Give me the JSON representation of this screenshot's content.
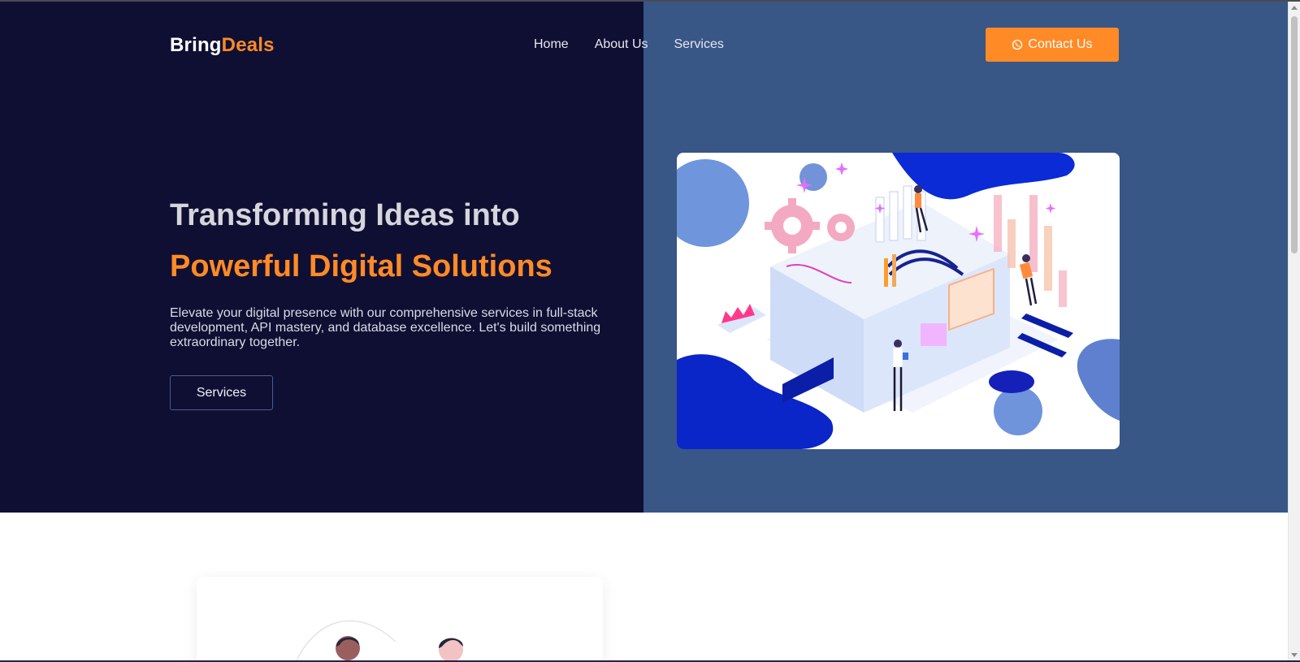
{
  "brand": {
    "part1": "Bring",
    "part2": "Deals"
  },
  "nav": {
    "items": [
      "Home",
      "About Us",
      "Services"
    ]
  },
  "header": {
    "contact_label": "Contact Us",
    "contact_icon": "whatsapp-icon"
  },
  "hero": {
    "title_line1": "Transforming Ideas into",
    "title_line2": "Powerful Digital Solutions",
    "description": "Elevate your digital presence with our comprehensive services in full-stack development, API mastery, and database excellence. Let's build something extraordinary together.",
    "cta_label": "Services"
  },
  "colors": {
    "hero_dark": "#0f0f33",
    "hero_right": "#385686",
    "accent": "#ff8a26",
    "title_light": "#d5d5dc"
  }
}
